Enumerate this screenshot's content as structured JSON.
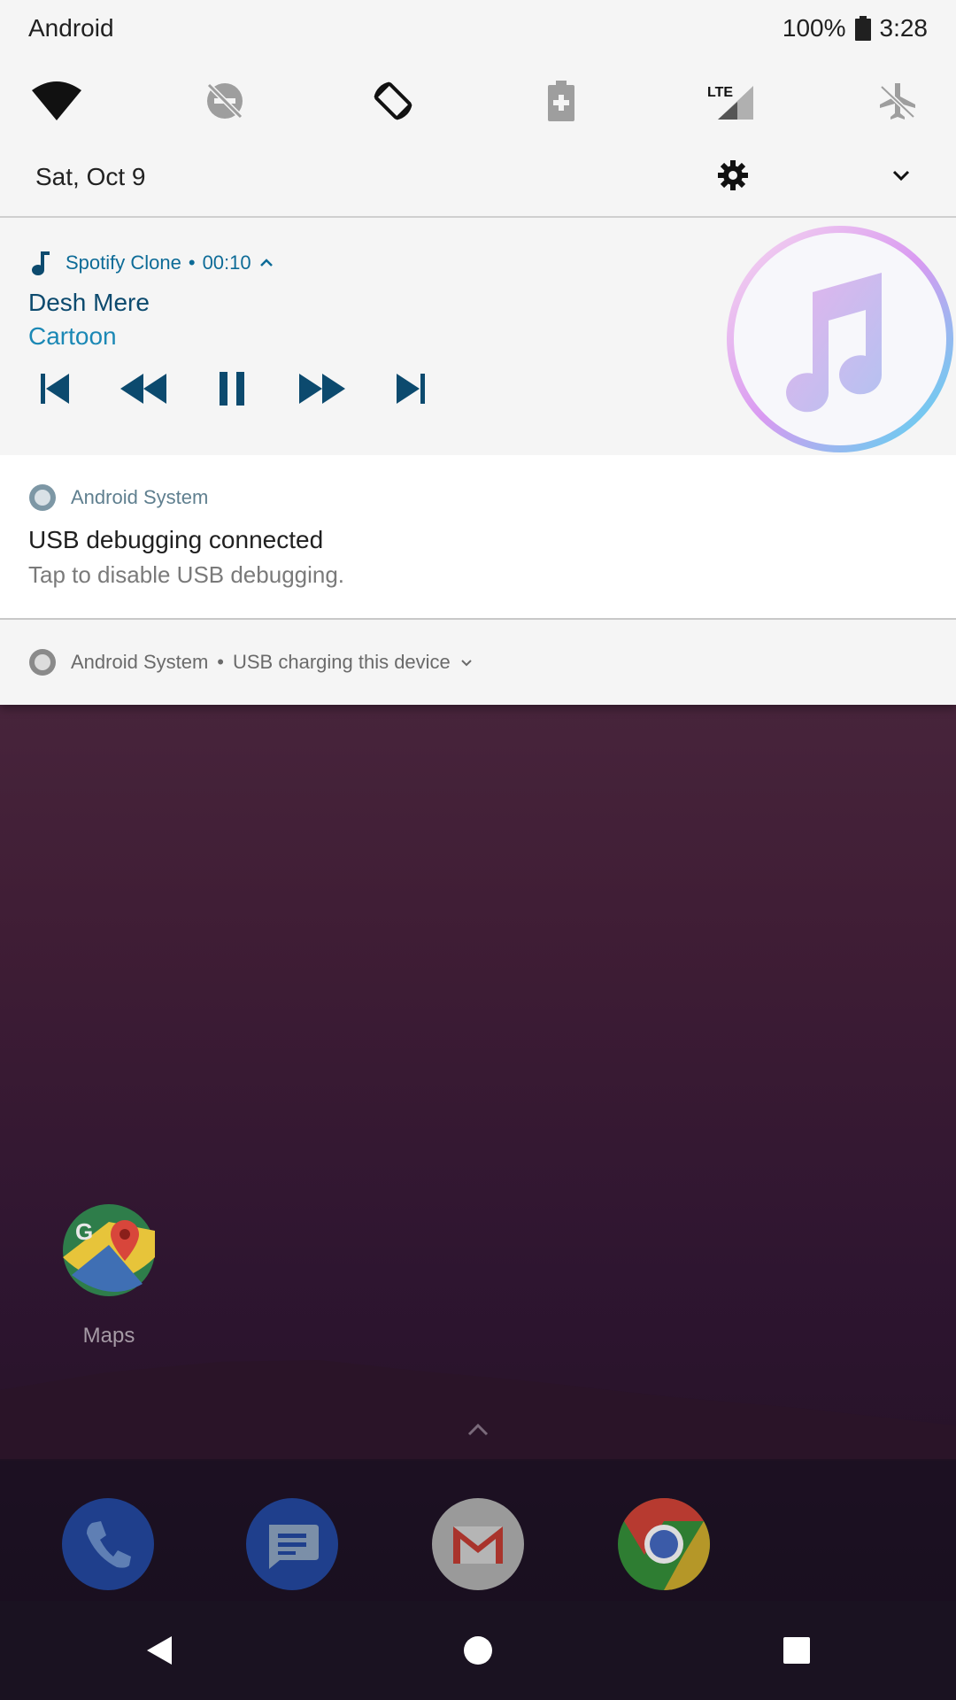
{
  "status_bar": {
    "carrier": "Android",
    "battery": "100%",
    "time": "3:28"
  },
  "quick_settings": {
    "tiles": [
      "wifi-icon",
      "dnd-icon",
      "auto-rotate-icon",
      "battery-saver-icon",
      "lte-signal-icon",
      "airplane-mode-icon"
    ],
    "lte_label": "LTE"
  },
  "date_row": {
    "date": "Sat, Oct 9"
  },
  "media_notification": {
    "app_name": "Spotify Clone",
    "separator": "•",
    "elapsed": "00:10",
    "song_title": "Desh Mere",
    "artist": "Cartoon",
    "controls": [
      "skip-previous-icon",
      "rewind-icon",
      "pause-icon",
      "fast-forward-icon",
      "skip-next-icon"
    ]
  },
  "usb_notification": {
    "app_name": "Android System",
    "title": "USB debugging connected",
    "text": "Tap to disable USB debugging."
  },
  "charging_notification": {
    "app_name": "Android System",
    "separator": "•",
    "text": "USB charging this device"
  },
  "home": {
    "maps_label": "Maps",
    "dock_apps": [
      "phone-app-icon",
      "messages-app-icon",
      "gmail-app-icon",
      "chrome-app-icon"
    ]
  },
  "colors": {
    "shade_bg": "#f5f5f5",
    "media_accent": "#0d6b97",
    "wallpaper_top": "#5a3448",
    "wallpaper_bottom": "#1e1020"
  }
}
